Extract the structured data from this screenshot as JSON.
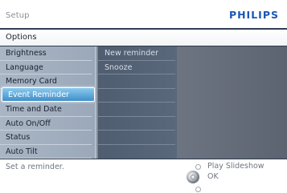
{
  "header": {
    "title": "Setup",
    "brand": "PHILIPS"
  },
  "section": {
    "title": "Options"
  },
  "left_menu": {
    "items": [
      {
        "label": "Brightness"
      },
      {
        "label": "Language"
      },
      {
        "label": "Memory Card"
      },
      {
        "label": "Event Reminder",
        "selected": true
      },
      {
        "label": "Time and Date"
      },
      {
        "label": "Auto On/Off"
      },
      {
        "label": "Status"
      },
      {
        "label": "Auto  Tilt"
      }
    ]
  },
  "sub_menu": {
    "items": [
      {
        "label": "New reminder"
      },
      {
        "label": "Snooze"
      }
    ]
  },
  "status": {
    "hint": "Set a reminder."
  },
  "controls": {
    "play_label": "Play Slideshow",
    "ok_label": "OK"
  },
  "colors": {
    "selection": "#3f8fc9",
    "brand": "#1b57b5",
    "panel": "#4d5766"
  }
}
